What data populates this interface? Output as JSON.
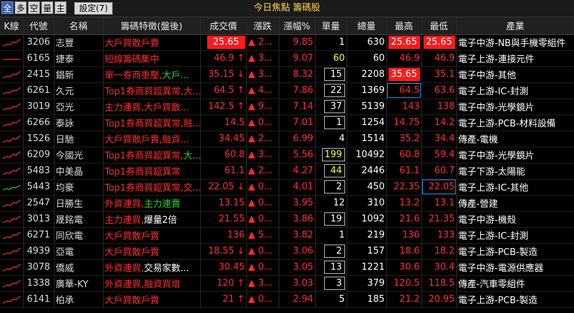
{
  "toolbar": {
    "tabs": [
      "全",
      "多",
      "空",
      "量",
      "主"
    ],
    "settings_label": "設定(7)",
    "title": "今日焦點 籌碼股"
  },
  "columns": [
    "K線",
    "代號",
    "名稱",
    "籌碼特徵(盤後)",
    "成交價",
    "漲跌",
    "漲幅%",
    "單量",
    "總量",
    "最高",
    "最低",
    "產業"
  ],
  "rows": [
    {
      "code": "3206",
      "name": "志豐",
      "feature": [
        {
          "t": "大戶買散戶賣",
          "c": "r"
        }
      ],
      "price": "25.65",
      "price_hl": true,
      "chg": "▲ 2...",
      "chg_c": "r",
      "pct": "9.85",
      "pct_c": "r",
      "vol": "1",
      "vol_box": false,
      "total": "630",
      "high": "25.65",
      "high_hl": true,
      "low": "25.65",
      "low_hl": true,
      "ind": "電子中游-NB與手機零組件",
      "spark": "up"
    },
    {
      "code": "6165",
      "name": "捷泰",
      "feature": [
        {
          "t": "短線籌碼集中",
          "c": "r"
        }
      ],
      "price": "46.9 ↑",
      "price_c": "r",
      "chg": "▲ 3...",
      "chg_c": "r",
      "pct": "9.07",
      "pct_c": "r",
      "vol": "60",
      "vol_box": false,
      "vol_c": "y",
      "total": "60",
      "high": "46.9",
      "high_c": "r",
      "low": "46.9",
      "low_c": "r",
      "ind": "電子上游-連接元件",
      "spark": "flat"
    },
    {
      "code": "2415",
      "name": "錩新",
      "feature": [
        {
          "t": "單一券商重壓,",
          "c": "r"
        },
        {
          "t": "大戶...",
          "c": "g"
        }
      ],
      "price": "35.15 ↓",
      "price_c": "r",
      "chg": "▲ 3...",
      "chg_c": "r",
      "pct": "8.32",
      "pct_c": "r",
      "vol": "15",
      "vol_box": true,
      "total": "2208",
      "high": "35.65",
      "high_hl": true,
      "low": "35.1",
      "low_c": "r",
      "ind": "電子中游-其他",
      "spark": "up"
    },
    {
      "code": "6261",
      "name": "久元",
      "feature": [
        {
          "t": "Top1券商買超異常,大...",
          "c": "r"
        }
      ],
      "price": "64.5 ↑",
      "price_c": "r",
      "chg": "▲ 4...",
      "chg_c": "r",
      "pct": "7.86",
      "pct_c": "r",
      "vol": "22",
      "vol_box": true,
      "total": "1369",
      "high": "64.5",
      "high_c": "r",
      "high_blue": true,
      "low": "63.6",
      "low_c": "r",
      "ind": "電子上游-IC-封測",
      "spark": "up"
    },
    {
      "code": "3019",
      "name": "亞光",
      "feature": [
        {
          "t": "主力連買,大戶買散...",
          "c": "r"
        }
      ],
      "price": "142.5 ↑",
      "price_c": "r",
      "chg": "▲ 9...",
      "chg_c": "r",
      "pct": "7.14",
      "pct_c": "r",
      "vol": "37",
      "vol_box": true,
      "total": "5139",
      "high": "143",
      "high_c": "r",
      "low": "138",
      "low_c": "r",
      "ind": "電子中游-光學鏡片",
      "spark": "up"
    },
    {
      "code": "6266",
      "name": "泰詠",
      "feature": [
        {
          "t": "Top1券商買超異常,融...",
          "c": "r"
        }
      ],
      "price": "14.5",
      "price_c": "r",
      "chg": "▲ 0...",
      "chg_c": "r",
      "pct": "7.01",
      "pct_c": "r",
      "vol": "1",
      "vol_box": true,
      "total": "1254",
      "high": "14.75",
      "high_c": "r",
      "low": "14.2",
      "low_c": "r",
      "ind": "電子上游-PCB-材料設備",
      "spark": "up"
    },
    {
      "code": "1526",
      "name": "日馳",
      "feature": [
        {
          "t": "大戶買散戶賣,融資...",
          "c": "r"
        }
      ],
      "price": "34.45",
      "price_c": "r",
      "chg": "▲ 2...",
      "chg_c": "r",
      "pct": "6.99",
      "pct_c": "r",
      "vol": "4",
      "vol_box": false,
      "total": "1514",
      "high": "35.2",
      "high_c": "r",
      "low": "34.4",
      "low_c": "r",
      "ind": "傳產-電機",
      "spark": "up"
    },
    {
      "code": "6209",
      "name": "今國光",
      "feature": [
        {
          "t": "Top1券商買超異常,",
          "c": "r"
        },
        {
          "t": "大...",
          "c": "g"
        }
      ],
      "price": "60.8",
      "price_c": "r",
      "chg": "▲ 3...",
      "chg_c": "r",
      "pct": "5.56",
      "pct_c": "r",
      "vol": "199",
      "vol_box": true,
      "vol_c": "y",
      "total": "10492",
      "high": "60.8",
      "high_c": "r",
      "low": "59.4",
      "low_c": "r",
      "ind": "電子中游-光學鏡片",
      "spark": "up"
    },
    {
      "code": "5483",
      "name": "中美晶",
      "feature": [
        {
          "t": "Top1券商買超異常",
          "c": "r"
        }
      ],
      "price": "61.1",
      "price_c": "r",
      "chg": "▲ 2...",
      "chg_c": "r",
      "pct": "4.27",
      "pct_c": "r",
      "vol": "44",
      "vol_box": true,
      "vol_c": "y",
      "total": "2446",
      "high": "61.1",
      "high_c": "r",
      "low": "60.7",
      "low_c": "r",
      "ind": "電子下游-太陽能",
      "spark": "up"
    },
    {
      "code": "5443",
      "name": "均豪",
      "feature": [
        {
          "t": "Top1券商買超異常,交...",
          "c": "r"
        }
      ],
      "price": "22.05 ↓",
      "price_c": "r",
      "chg": "▲ 0...",
      "chg_c": "r",
      "pct": "4.01",
      "pct_c": "r",
      "vol": "2",
      "vol_box": true,
      "total": "450",
      "high": "22.35",
      "high_c": "r",
      "low": "22.05",
      "low_c": "r",
      "low_blue": true,
      "ind": "電子上游-IC-其他",
      "spark": "green"
    },
    {
      "code": "2547",
      "name": "日勝生",
      "feature": [
        {
          "t": "外資連買,",
          "c": "r"
        },
        {
          "t": "主力連賣",
          "c": "g"
        }
      ],
      "price": "13.15",
      "price_c": "r",
      "chg": "▲ 0...",
      "chg_c": "r",
      "pct": "3.95",
      "pct_c": "r",
      "vol": "12",
      "vol_box": false,
      "total": "310",
      "high": "13.2",
      "high_c": "r",
      "low": "13.1",
      "low_c": "r",
      "ind": "傳產-營建",
      "spark": "up"
    },
    {
      "code": "3013",
      "name": "晟銘電",
      "feature": [
        {
          "t": "主力連買,",
          "c": "r"
        },
        {
          "t": "爆量2倍",
          "c": "w"
        }
      ],
      "price": "21.55",
      "price_c": "r",
      "chg": "▲ 0...",
      "chg_c": "r",
      "pct": "3.86",
      "pct_c": "r",
      "vol": "19",
      "vol_box": true,
      "total": "1092",
      "high": "21.6",
      "high_c": "r",
      "low": "21.35",
      "low_c": "r",
      "ind": "電子中游-機殼",
      "spark": "up"
    },
    {
      "code": "6271",
      "name": "同欣電",
      "feature": [
        {
          "t": "大戶買散戶賣",
          "c": "r"
        }
      ],
      "price": "136",
      "price_c": "r",
      "chg": "▲ 5...",
      "chg_c": "r",
      "pct": "3.82",
      "pct_c": "r",
      "vol": "1",
      "vol_box": false,
      "total": "219",
      "high": "136",
      "high_c": "r",
      "low": "133",
      "low_c": "r",
      "ind": "電子上游-IC-封測",
      "spark": "up"
    },
    {
      "code": "4939",
      "name": "亞電",
      "feature": [
        {
          "t": "大戶買散戶賣",
          "c": "r"
        }
      ],
      "price": "18.55 ↓",
      "price_c": "r",
      "chg": "▲ 0...",
      "chg_c": "r",
      "pct": "3.06",
      "pct_c": "r",
      "vol": "2",
      "vol_box": true,
      "total": "157",
      "high": "18.6",
      "high_c": "r",
      "low": "18.2",
      "low_c": "r",
      "ind": "電子上游-PCB-製造",
      "spark": "up"
    },
    {
      "code": "3078",
      "name": "僑威",
      "feature": [
        {
          "t": "外資連買,",
          "c": "r"
        },
        {
          "t": "交易家數...",
          "c": "w"
        }
      ],
      "price": "30.45",
      "price_c": "r",
      "chg": "▲ 0...",
      "chg_c": "r",
      "pct": "3.05",
      "pct_c": "r",
      "vol": "13",
      "vol_box": true,
      "total": "1221",
      "high": "30.6",
      "high_c": "r",
      "low": "30.4",
      "low_c": "r",
      "ind": "電子中游-電源供應器",
      "spark": "up"
    },
    {
      "code": "1338",
      "name": "廣華-KY",
      "feature": [
        {
          "t": "外資連買,融資買增",
          "c": "r"
        }
      ],
      "price": "120 ↑",
      "price_c": "r",
      "chg": "▲ 3...",
      "chg_c": "r",
      "pct": "3.03",
      "pct_c": "r",
      "vol": "3",
      "vol_box": true,
      "total": "379",
      "high": "120.5",
      "high_c": "r",
      "low": "118.5",
      "low_c": "r",
      "ind": "傳產-汽車零組件",
      "spark": "up"
    },
    {
      "code": "6141",
      "name": "柏承",
      "feature": [
        {
          "t": "大戶買散戶賣",
          "c": "r"
        }
      ],
      "price": "21 ↑",
      "price_c": "r",
      "chg": "▲ 0...",
      "chg_c": "r",
      "pct": "2.94",
      "pct_c": "r",
      "vol": "5",
      "vol_box": false,
      "total": "185",
      "high": "21.2",
      "high_c": "r",
      "low": "20.95",
      "low_c": "r",
      "ind": "電子上游-PCB-製造",
      "spark": "up"
    }
  ]
}
